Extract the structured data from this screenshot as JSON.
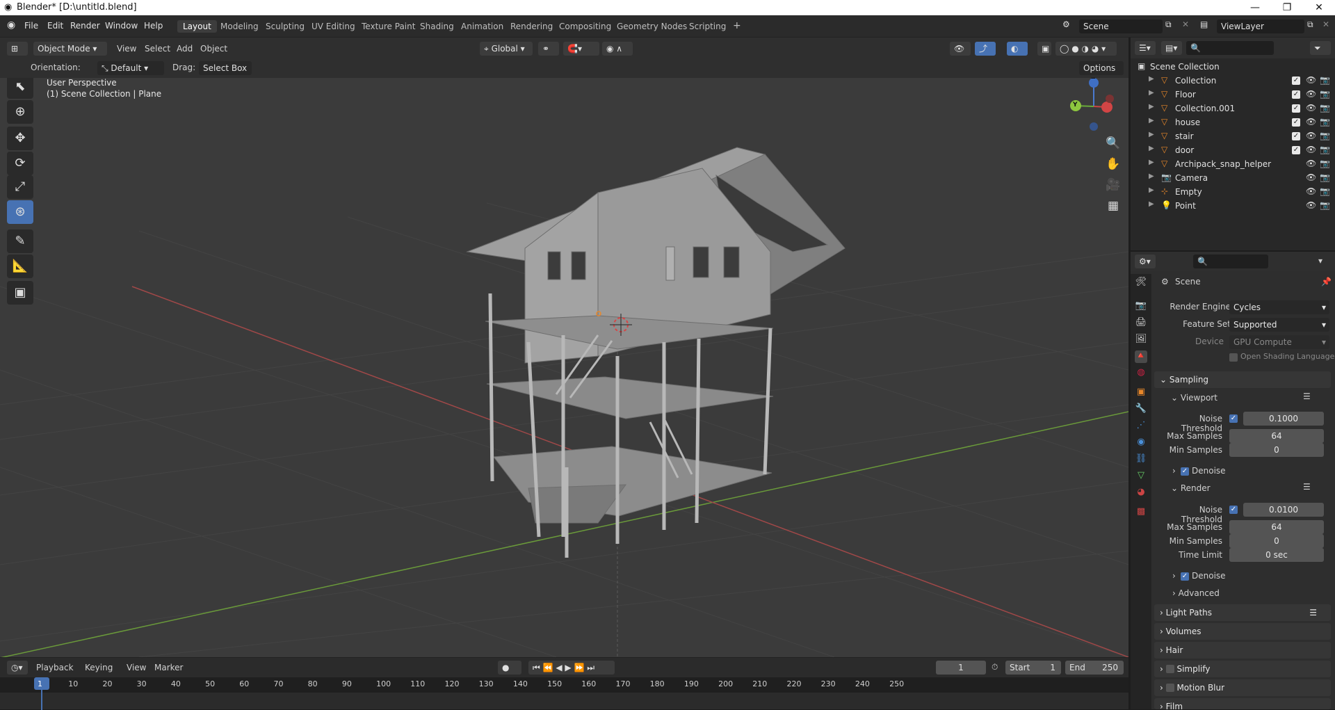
{
  "window": {
    "title": "Blender* [D:\\untitld.blend]",
    "minimize": "—",
    "maximize": "❐",
    "close": "✕"
  },
  "menu": {
    "items": [
      "File",
      "Edit",
      "Render",
      "Window",
      "Help"
    ]
  },
  "workspaces": {
    "tabs": [
      "Layout",
      "Modeling",
      "Sculpting",
      "UV Editing",
      "Texture Paint",
      "Shading",
      "Animation",
      "Rendering",
      "Compositing",
      "Geometry Nodes",
      "Scripting"
    ],
    "active": "Layout",
    "add": "+"
  },
  "scene": {
    "name": "Scene",
    "view_layer": "ViewLayer"
  },
  "viewport_header": {
    "mode": "Object Mode",
    "menus": [
      "View",
      "Select",
      "Add",
      "Object"
    ],
    "transform": "Global",
    "options": "Options"
  },
  "tool_header": {
    "orientation_label": "Orientation:",
    "orientation_value": "Default",
    "drag_label": "Drag:",
    "drag_value": "Select Box"
  },
  "viewport": {
    "perspective": "User Perspective",
    "context": "(1) Scene Collection | Plane",
    "gizmo": {
      "z": "Z",
      "y": "Y"
    }
  },
  "outliner": {
    "root": "Scene Collection",
    "items": [
      {
        "name": "Collection",
        "icon": "collection-icon"
      },
      {
        "name": "Floor",
        "icon": "collection-icon"
      },
      {
        "name": "Collection.001",
        "icon": "collection-icon"
      },
      {
        "name": "house",
        "icon": "collection-icon"
      },
      {
        "name": "stair",
        "icon": "collection-icon"
      },
      {
        "name": "door",
        "icon": "collection-icon"
      },
      {
        "name": "Archipack_snap_helper",
        "icon": "mesh-icon"
      },
      {
        "name": "Camera",
        "icon": "camera-icon"
      },
      {
        "name": "Empty",
        "icon": "empty-icon"
      },
      {
        "name": "Point",
        "icon": "light-icon"
      }
    ]
  },
  "properties": {
    "context": "Scene",
    "render_engine_label": "Render Engine",
    "render_engine": "Cycles",
    "feature_set_label": "Feature Set",
    "feature_set": "Supported",
    "device_label": "Device",
    "device": "GPU Compute",
    "osl": "Open Shading Language",
    "sampling": "Sampling",
    "viewport_sub": "Viewport",
    "render_sub": "Render",
    "noise_threshold_label": "Noise Threshold",
    "viewport_noise": "0.1000",
    "max_samples_label": "Max Samples",
    "viewport_max": "64",
    "min_samples_label": "Min Samples",
    "viewport_min": "0",
    "denoise": "Denoise",
    "render_noise": "0.0100",
    "render_max": "64",
    "render_min": "0",
    "time_limit_label": "Time Limit",
    "time_limit": "0 sec",
    "advanced": "Advanced",
    "panels": [
      "Light Paths",
      "Volumes",
      "Hair",
      "Simplify",
      "Motion Blur",
      "Film"
    ]
  },
  "timeline": {
    "menus": [
      "Playback",
      "Keying",
      "View",
      "Marker"
    ],
    "current_frame": "1",
    "start_label": "Start",
    "start": "1",
    "end_label": "End",
    "end": "250",
    "ticks": [
      "1",
      "10",
      "20",
      "30",
      "40",
      "50",
      "60",
      "70",
      "80",
      "90",
      "100",
      "110",
      "120",
      "130",
      "140",
      "150",
      "160",
      "170",
      "180",
      "190",
      "200",
      "210",
      "220",
      "230",
      "240",
      "250"
    ]
  }
}
